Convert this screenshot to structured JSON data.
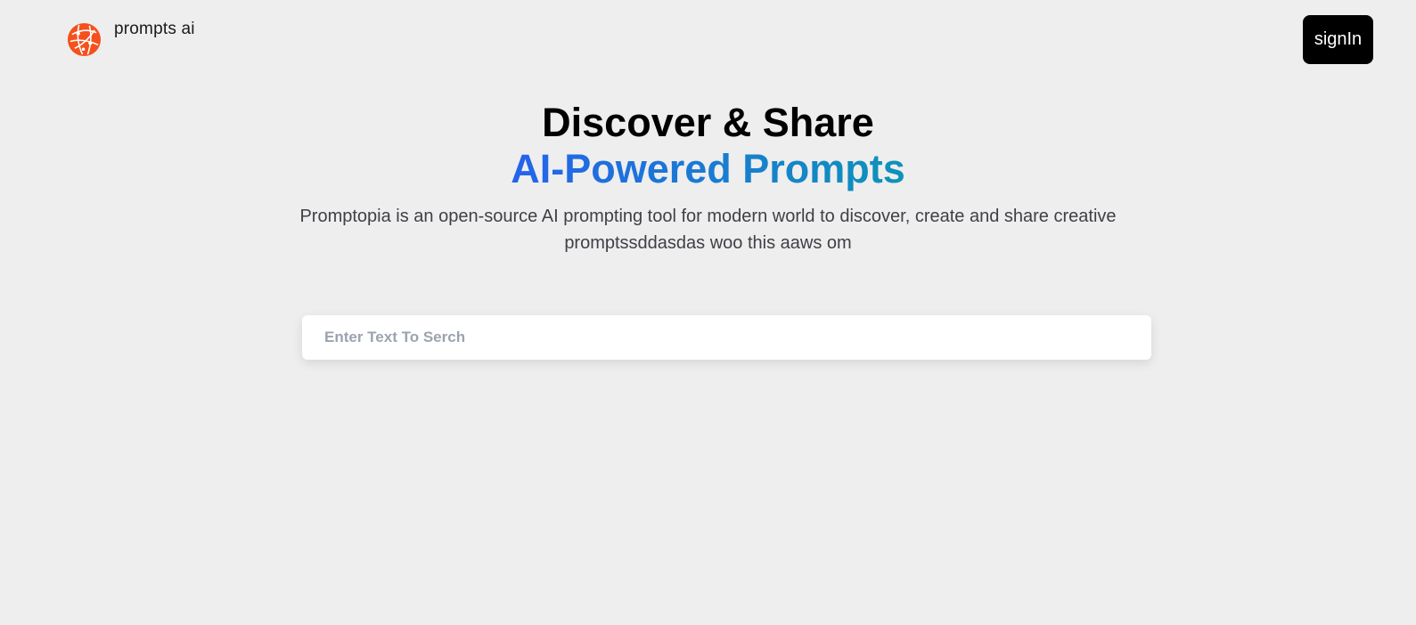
{
  "nav": {
    "brand_name": "prompts ai",
    "logo_icon": "globe-network-icon",
    "signin_label": "signIn"
  },
  "hero": {
    "title_line1": "Discover & Share",
    "title_line2": "AI-Powered Prompts",
    "description": "Promptopia is an open-source AI prompting tool for modern world to discover, create and share creative promptssddasdas woo this aaws om"
  },
  "search": {
    "value": "",
    "placeholder": "Enter Text To Serch"
  },
  "colors": {
    "background": "#eeeeee",
    "logo": "#f4511e",
    "gradient_start": "#2563eb",
    "gradient_end": "#0e93b8",
    "button_bg": "#000000"
  }
}
